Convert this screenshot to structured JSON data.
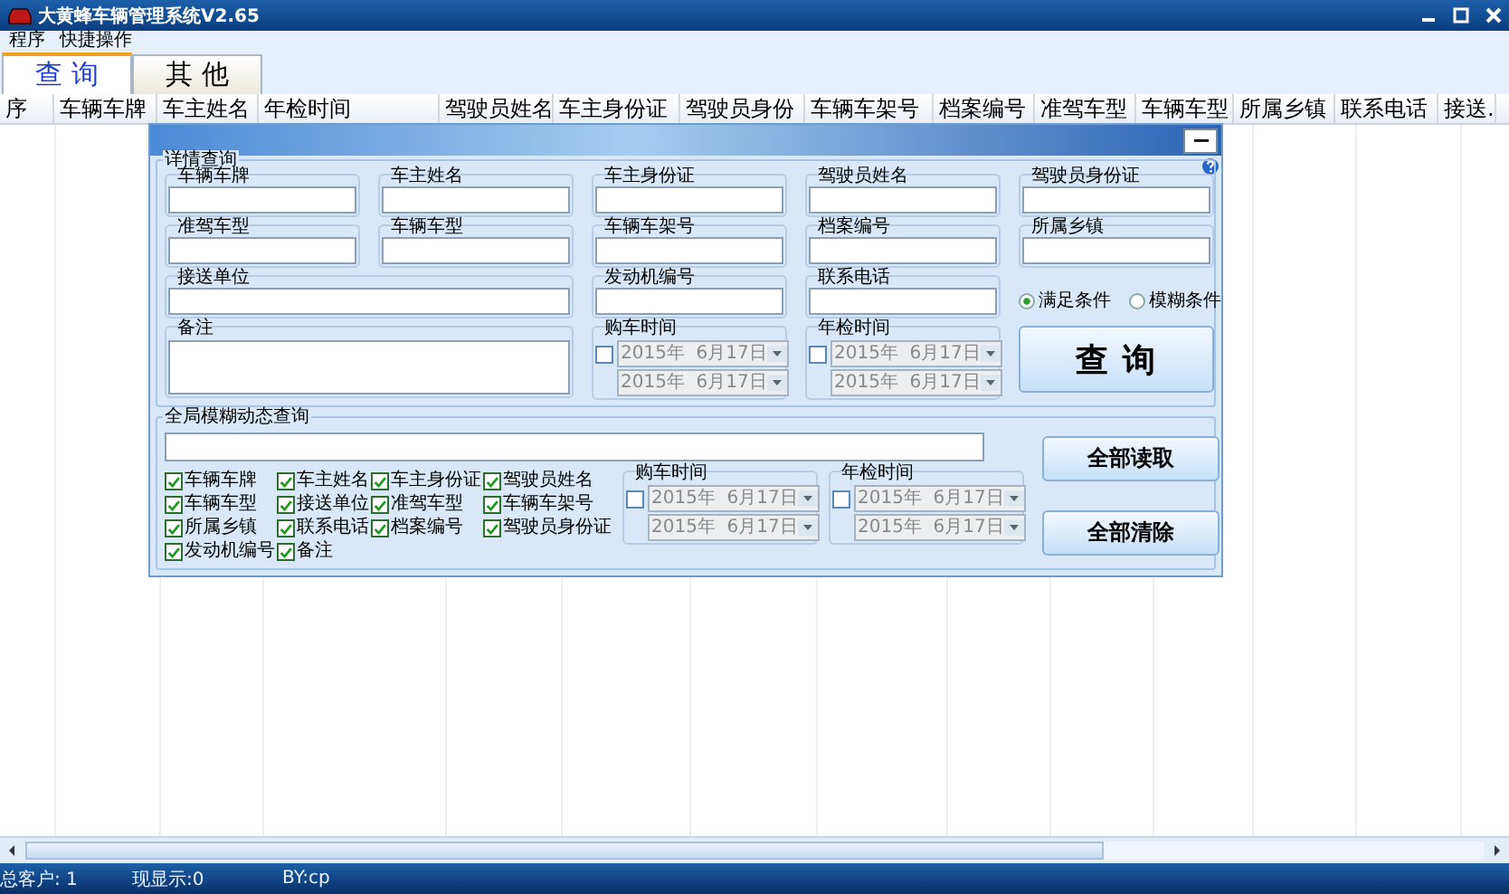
{
  "window": {
    "title": "大黄蜂车辆管理系统V2.65"
  },
  "menu": [
    "程序",
    "快捷操作"
  ],
  "tabs": [
    {
      "label": "查 询",
      "selected": true
    },
    {
      "label": "其 他",
      "selected": false
    }
  ],
  "table": {
    "columns": [
      "序",
      "车辆车牌",
      "车主姓名",
      "年检时间",
      "驾驶员姓名",
      "车主身份证",
      "驾驶员身份",
      "车辆车架号",
      "档案编号",
      "准驾车型",
      "车辆车型",
      "所属乡镇",
      "联系电话",
      "接送."
    ]
  },
  "dialog": {
    "detail_query": {
      "title": "详情查询",
      "fields": [
        {
          "label": "车辆车牌",
          "kind": "text"
        },
        {
          "label": "车主姓名",
          "kind": "text"
        },
        {
          "label": "车主身份证",
          "kind": "text"
        },
        {
          "label": "驾驶员姓名",
          "kind": "text"
        },
        {
          "label": "驾驶员身份证",
          "kind": "text"
        },
        {
          "label": "准驾车型",
          "kind": "text"
        },
        {
          "label": "车辆车型",
          "kind": "text"
        },
        {
          "label": "车辆车架号",
          "kind": "text"
        },
        {
          "label": "档案编号",
          "kind": "text"
        },
        {
          "label": "所属乡镇",
          "kind": "text"
        },
        {
          "label": "接送单位",
          "kind": "wide"
        },
        {
          "label": "发动机编号",
          "kind": "text"
        },
        {
          "label": "联系电话",
          "kind": "text"
        }
      ],
      "match_modes": [
        {
          "label": "满足条件",
          "selected": true
        },
        {
          "label": "模糊条件",
          "selected": false
        }
      ],
      "note": {
        "label": "备注"
      },
      "date_ranges": [
        {
          "label": "购车时间",
          "checked": false,
          "from": "2015年  6月17日",
          "to": "2015年  6月17日"
        },
        {
          "label": "年检时间",
          "checked": false,
          "from": "2015年  6月17日",
          "to": "2015年  6月17日"
        }
      ],
      "search_button": "查 询"
    },
    "global_query": {
      "title": "全局模糊动态查询",
      "fields": [
        {
          "label": "车辆车牌",
          "checked": true
        },
        {
          "label": "车主姓名",
          "checked": true
        },
        {
          "label": "车主身份证",
          "checked": true
        },
        {
          "label": "驾驶员姓名",
          "checked": true
        },
        {
          "label": "车辆车型",
          "checked": true
        },
        {
          "label": "接送单位",
          "checked": true
        },
        {
          "label": "准驾车型",
          "checked": true
        },
        {
          "label": "车辆车架号",
          "checked": true
        },
        {
          "label": "所属乡镇",
          "checked": true
        },
        {
          "label": "联系电话",
          "checked": true
        },
        {
          "label": "档案编号",
          "checked": true
        },
        {
          "label": "驾驶员身份证",
          "checked": true
        },
        {
          "label": "发动机编号",
          "checked": true
        },
        {
          "label": "备注",
          "checked": true
        }
      ],
      "date_ranges": [
        {
          "label": "购车时间",
          "checked": false,
          "from": "2015年  6月17日",
          "to": "2015年  6月17日"
        },
        {
          "label": "年检时间",
          "checked": false,
          "from": "2015年  6月17日",
          "to": "2015年  6月17日"
        }
      ],
      "buttons": [
        "全部读取",
        "全部清除"
      ]
    }
  },
  "status_bar": [
    "总客户: 1",
    "现显示:0",
    "BY:cp"
  ]
}
